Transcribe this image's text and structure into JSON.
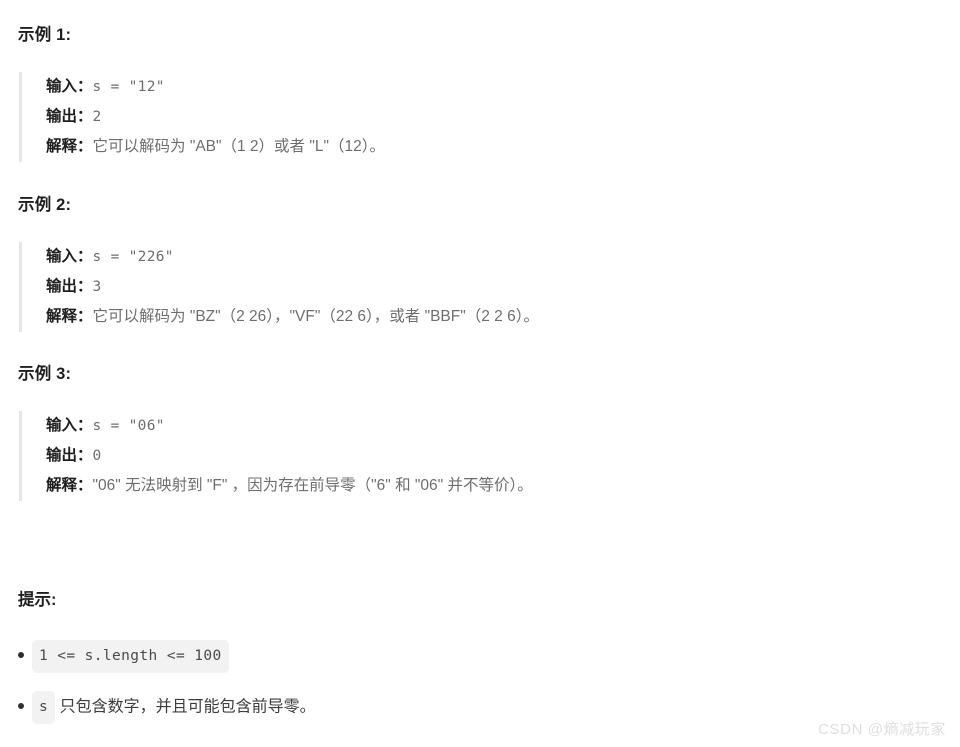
{
  "examples": [
    {
      "heading": "示例 1:",
      "input_label": "输入：",
      "input_value": "s = \"12\"",
      "output_label": "输出：",
      "output_value": "2",
      "explain_label": "解释：",
      "explain_value": "它可以解码为 \"AB\"（1 2）或者 \"L\"（12）。"
    },
    {
      "heading": "示例 2:",
      "input_label": "输入：",
      "input_value": "s = \"226\"",
      "output_label": "输出：",
      "output_value": "3",
      "explain_label": "解释：",
      "explain_value": "它可以解码为 \"BZ\"（2 26），\"VF\"（22 6），或者 \"BBF\"（2 2 6）。"
    },
    {
      "heading": "示例 3:",
      "input_label": "输入：",
      "input_value": "s = \"06\"",
      "output_label": "输出：",
      "output_value": "0",
      "explain_label": "解释：",
      "explain_value": "\"06\" 无法映射到 \"F\" ，因为存在前导零（\"6\" 和 \"06\" 并不等价）。"
    }
  ],
  "hints": {
    "heading": "提示:",
    "items": [
      {
        "code": "1 <= s.length <= 100",
        "text": ""
      },
      {
        "code": "s",
        "text": " 只包含数字，并且可能包含前导零。"
      }
    ]
  },
  "watermark": {
    "text": "CSDN @熵减玩家"
  },
  "colors": {
    "heading": "#1f1f1f",
    "body_text": "#3c3c3c",
    "muted_text": "#6e6e6e",
    "blockquote_bar": "#e6e6e6",
    "code_chip_bg": "#f2f2f2",
    "watermark": "#dedede",
    "page_bg": "#ffffff"
  }
}
